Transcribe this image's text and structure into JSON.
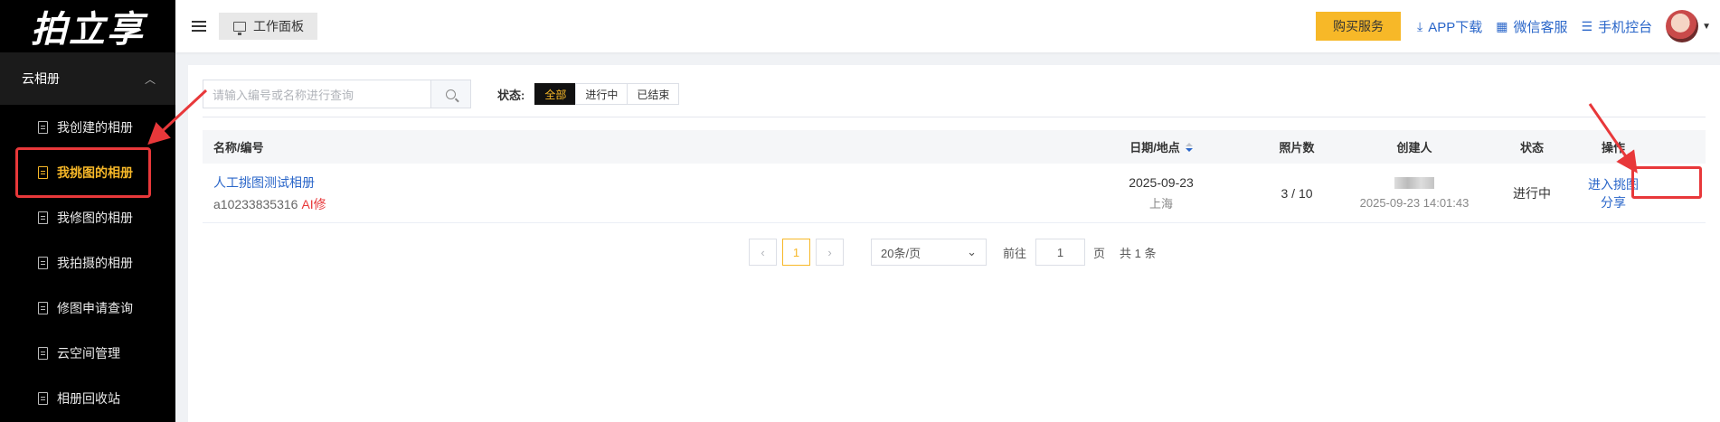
{
  "logo": "拍立享",
  "sidebar": {
    "group_label": "云相册",
    "items": [
      {
        "label": "我创建的相册"
      },
      {
        "label": "我挑图的相册"
      },
      {
        "label": "我修图的相册"
      },
      {
        "label": "我拍摄的相册"
      },
      {
        "label": "修图申请查询"
      },
      {
        "label": "云空间管理"
      },
      {
        "label": "相册回收站"
      }
    ]
  },
  "header": {
    "workbench": "工作面板",
    "buy": "购买服务",
    "app_download": "APP下载",
    "wechat_service": "微信客服",
    "mobile_console": "手机控台"
  },
  "filter": {
    "search_placeholder": "请输入编号或名称进行查询",
    "status_label": "状态:",
    "status_options": [
      "全部",
      "进行中",
      "已结束"
    ],
    "status_selected": "全部"
  },
  "table": {
    "headers": {
      "name": "名称/编号",
      "date": "日期/地点",
      "photos": "照片数",
      "creator": "创建人",
      "status": "状态",
      "ops": "操作"
    },
    "rows": [
      {
        "name": "人工挑图测试相册",
        "code": "a10233835316",
        "ai_tag": "AI修",
        "date": "2025-09-23",
        "location": "上海",
        "photos": "3 /  10",
        "created_at": "2025-09-23 14:01:43",
        "status": "进行中",
        "op_enter": "进入挑图",
        "op_share": "分享"
      }
    ]
  },
  "pagination": {
    "current_page": "1",
    "page_size": "20条/页",
    "goto_label": "前往",
    "goto_value": "1",
    "page_unit": "页",
    "total": "共 1 条"
  },
  "colors": {
    "accent": "#f7b828",
    "link": "#2a66c9",
    "annotation": "#e8383a"
  }
}
